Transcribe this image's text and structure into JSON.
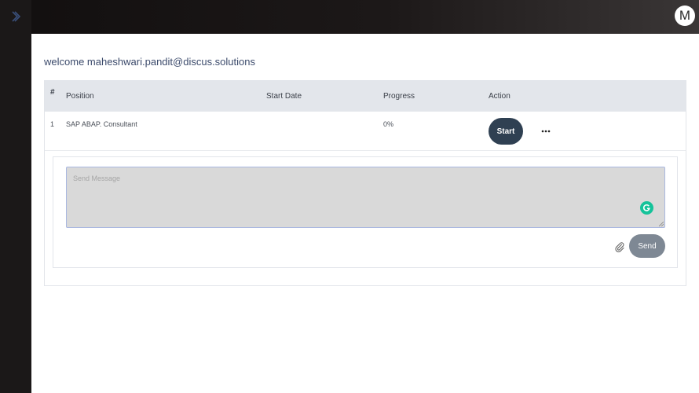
{
  "header": {
    "avatar_initial": "M"
  },
  "welcome": {
    "text": "welcome maheshwari.pandit@discus.solutions"
  },
  "table": {
    "columns": [
      "#",
      "Position",
      "Start Date",
      "Progress",
      "Action"
    ],
    "rows": [
      {
        "index": "1",
        "position": "SAP ABAP. Consultant",
        "start_date": "",
        "progress": "0%",
        "action_label": "Start",
        "more_label": "..."
      }
    ]
  },
  "message": {
    "placeholder": "Send Message",
    "value": "",
    "send_label": "Send"
  },
  "icons": {
    "sidebar_toggle": "chevron-right-icon",
    "more": "ellipsis-icon",
    "attach": "paperclip-icon",
    "grammarly": "grammarly-icon"
  },
  "colors": {
    "topbar": "#1b1717",
    "start_button": "#2f4052",
    "send_button": "#7e8894",
    "table_header": "#e3e6eb",
    "welcome_text": "#3b4a6b",
    "grammarly": "#15c39a"
  }
}
